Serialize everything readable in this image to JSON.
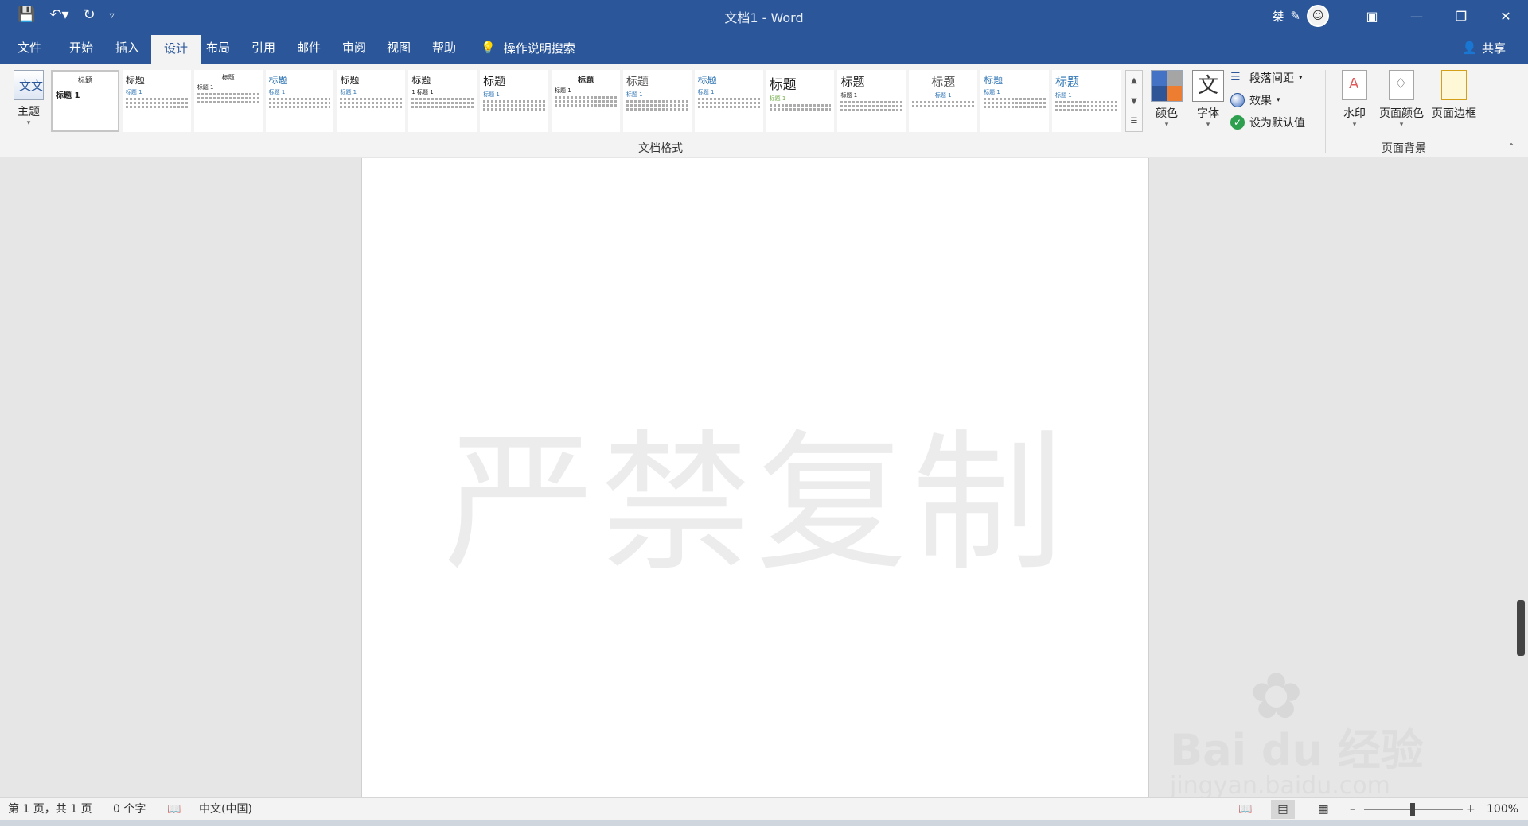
{
  "titlebar": {
    "quick_access": [
      "save-icon",
      "undo-icon",
      "redo-icon",
      "customize-icon"
    ],
    "title": "文档1  -  Word",
    "user_name": "桀",
    "window_controls": [
      "ribbon-display-icon",
      "minimize-icon",
      "restore-icon",
      "close-icon"
    ]
  },
  "menu": {
    "tabs": [
      "文件",
      "开始",
      "插入",
      "设计",
      "布局",
      "引用",
      "邮件",
      "审阅",
      "视图",
      "帮助"
    ],
    "active_tab": "设计",
    "search": "操作说明搜索",
    "share": "共享"
  },
  "ribbon": {
    "theme": "主题",
    "theme_icon_text": "文文",
    "gallery": [
      {
        "title": "标题",
        "sub": "标题 1"
      },
      {
        "title": "标题",
        "sub": "标题 1"
      },
      {
        "title": "标题",
        "sub": "标题 1"
      },
      {
        "title": "标题",
        "sub": "标题 1"
      },
      {
        "title": "标题",
        "sub": "标题 1"
      },
      {
        "title": "标题",
        "sub": "1 标题 1"
      },
      {
        "title": "标题",
        "sub": "标题 1"
      },
      {
        "title": "标题",
        "sub": "标题 1"
      },
      {
        "title": "标题",
        "sub": "标题 1"
      },
      {
        "title": "标题",
        "sub": "标题 1"
      },
      {
        "title": "标题",
        "sub": "标题 1"
      },
      {
        "title": "标题",
        "sub": "标题 1"
      },
      {
        "title": "标题",
        "sub": "标题 1"
      },
      {
        "title": "标题",
        "sub": "标题 1"
      },
      {
        "title": "标题",
        "sub": "标题 1"
      }
    ],
    "group_document_format": "文档格式",
    "colors": "颜色",
    "fonts": "字体",
    "fonts_icon_text": "文",
    "paragraph_spacing": "段落间距",
    "effects": "效果",
    "set_default": "设为默认值",
    "watermark": "水印",
    "page_color": "页面颜色",
    "page_borders": "页面边框",
    "group_page_background": "页面背景",
    "color_swatches": [
      "#4472c4",
      "#a5a5a5",
      "#2f5597",
      "#ed7d31"
    ]
  },
  "document": {
    "watermark_text": "严禁复制"
  },
  "overlay": {
    "brand": "Bai du 经验",
    "url": "jingyan.baidu.com"
  },
  "status": {
    "page": "第 1 页，共 1 页",
    "words": "0 个字",
    "language": "中文(中国)",
    "zoom": "100%",
    "zoom_level": 1.0
  }
}
